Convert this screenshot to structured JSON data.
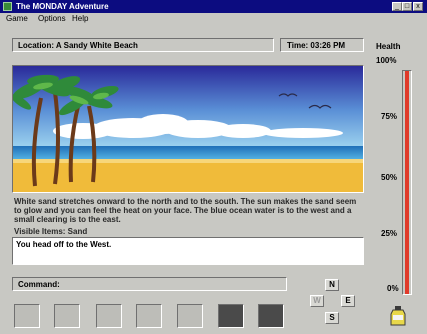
{
  "window": {
    "title": "The MONDAY Adventure",
    "controls": {
      "minimize": "_",
      "maximize": "□",
      "close": "x"
    }
  },
  "menu": {
    "items": [
      "Game",
      "Options",
      "Help"
    ]
  },
  "location": {
    "text": "Location:  A Sandy White Beach"
  },
  "time": {
    "text": "Time:   03:26 PM"
  },
  "scene": {
    "icon": "beach-scene",
    "colors": {
      "sky_top": "#2a2a9a",
      "sky_bottom": "#9ad0ee",
      "sea": "#2f8fcf",
      "sand": "#f0bb3a"
    }
  },
  "description": {
    "text": "White sand stretches onward to the north and to the south.  The sun makes the sand seem to glow and you can feel the heat on your face.  The blue ocean water is to the west and a small clearing is to the east.",
    "visible_items": "Visible Items:  Sand"
  },
  "result": {
    "text": "You head off to the West."
  },
  "command": {
    "label": "Command:",
    "value": ""
  },
  "inventory": {
    "slots": [
      {
        "filled": false
      },
      {
        "filled": false
      },
      {
        "filled": false
      },
      {
        "filled": false
      },
      {
        "filled": false
      },
      {
        "filled": true
      },
      {
        "filled": true
      }
    ]
  },
  "compass": {
    "north": "N",
    "west": "W",
    "east": "E",
    "south": "S"
  },
  "health": {
    "label": "Health",
    "percent": 100,
    "ticks": [
      "100%",
      "75%",
      "50%",
      "25%",
      "0%"
    ],
    "bar_color": "#e03a2a",
    "icon": "pep-bottle-icon"
  }
}
